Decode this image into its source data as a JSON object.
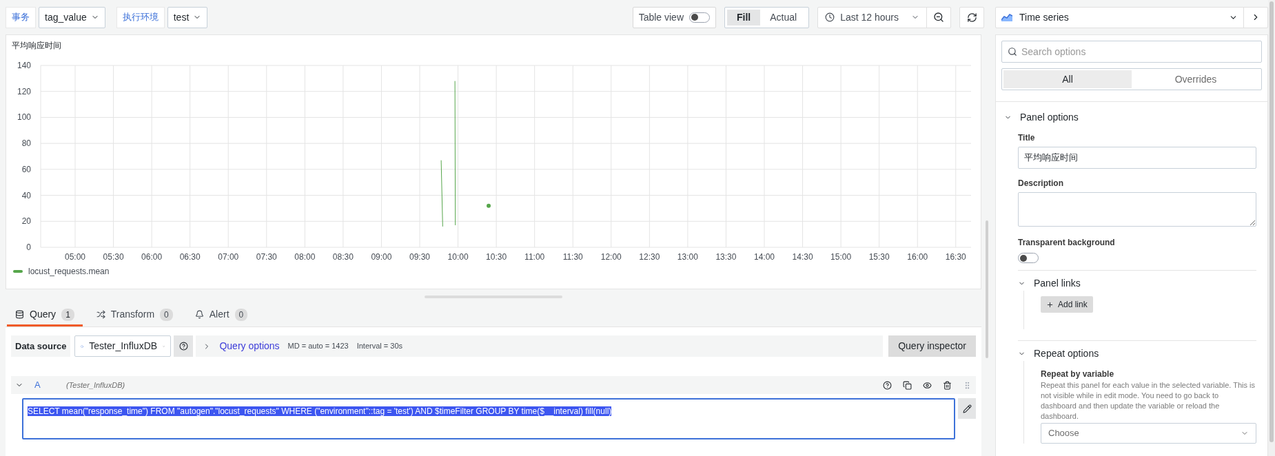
{
  "toolbar": {
    "variables": [
      {
        "label": "事务",
        "value": "tag_value"
      },
      {
        "label": "执行环境",
        "value": "test"
      }
    ],
    "table_view": {
      "label": "Table view",
      "on": false
    },
    "fill_modes": [
      {
        "label": "Fill",
        "selected": true
      },
      {
        "label": "Actual",
        "selected": false
      }
    ],
    "time_range": "Last 12 hours"
  },
  "visualization": {
    "name": "Time series"
  },
  "panel": {
    "title": "平均响应时间",
    "chart_data": {
      "type": "line",
      "grid": true,
      "x": [
        9.78,
        9.8,
        9.81,
        9.96,
        9.965,
        10.0,
        10.4
      ],
      "xlim": [
        4.55,
        16.7
      ],
      "ylim": [
        0,
        140
      ],
      "xticks": [
        {
          "value": 5,
          "label": "05:00"
        },
        {
          "value": 5.5,
          "label": "05:30"
        },
        {
          "value": 6,
          "label": "06:00"
        },
        {
          "value": 6.5,
          "label": "06:30"
        },
        {
          "value": 7,
          "label": "07:00"
        },
        {
          "value": 7.5,
          "label": "07:30"
        },
        {
          "value": 8,
          "label": "08:00"
        },
        {
          "value": 8.5,
          "label": "08:30"
        },
        {
          "value": 9,
          "label": "09:00"
        },
        {
          "value": 9.5,
          "label": "09:30"
        },
        {
          "value": 10,
          "label": "10:00"
        },
        {
          "value": 10.5,
          "label": "10:30"
        },
        {
          "value": 11,
          "label": "11:00"
        },
        {
          "value": 11.5,
          "label": "11:30"
        },
        {
          "value": 12,
          "label": "12:00"
        },
        {
          "value": 12.5,
          "label": "12:30"
        },
        {
          "value": 13,
          "label": "13:00"
        },
        {
          "value": 13.5,
          "label": "13:30"
        },
        {
          "value": 14,
          "label": "14:00"
        },
        {
          "value": 14.5,
          "label": "14:30"
        },
        {
          "value": 15,
          "label": "15:00"
        },
        {
          "value": 15.5,
          "label": "15:30"
        },
        {
          "value": 16,
          "label": "16:00"
        },
        {
          "value": 16.5,
          "label": "16:30"
        }
      ],
      "yticks": [
        0,
        20,
        40,
        60,
        80,
        100,
        120,
        140
      ],
      "series": [
        {
          "name": "locust_requests.mean",
          "color": "#56a64b",
          "values": [
            67,
            16,
            null,
            128,
            17,
            null,
            32
          ]
        }
      ]
    }
  },
  "tabs": [
    {
      "label": "Query",
      "count": "1",
      "selected": true
    },
    {
      "label": "Transform",
      "count": "0",
      "selected": false
    },
    {
      "label": "Alert",
      "count": "0",
      "selected": false
    }
  ],
  "query_bar": {
    "data_source_label": "Data source",
    "data_source": "Tester_InfluxDB",
    "query_options_label": "Query options",
    "max_data_points": "MD = auto = 1423",
    "interval": "Interval = 30s",
    "inspector": "Query inspector"
  },
  "queries": [
    {
      "ref": "A",
      "source": "(Tester_InfluxDB)",
      "expanded": true,
      "highlighted": true,
      "text": "SELECT mean(\"response_time\") FROM \"autogen\".\"locust_requests\" WHERE (\"environment\"::tag = 'test') AND $timeFilter GROUP BY time($__interval) fill(null)"
    }
  ],
  "options": {
    "search_placeholder": "Search options",
    "tabs": [
      {
        "label": "All",
        "selected": true
      },
      {
        "label": "Overrides",
        "selected": false
      }
    ],
    "panel_options": {
      "heading": "Panel options",
      "expanded": true,
      "title_label": "Title",
      "title_value": "平均响应时间",
      "description_label": "Description",
      "transparent_label": "Transparent background",
      "transparent_on": false
    },
    "panel_links": {
      "heading": "Panel links",
      "expanded": true,
      "add_label": "Add link"
    },
    "repeat_options": {
      "heading": "Repeat options",
      "expanded": true,
      "variable_label": "Repeat by variable",
      "variable_help": "Repeat this panel for each value in the selected variable. This is not visible while in edit mode. You need to go back to dashboard and then update the variable or reload the dashboard.",
      "variable_placeholder": "Choose"
    }
  }
}
